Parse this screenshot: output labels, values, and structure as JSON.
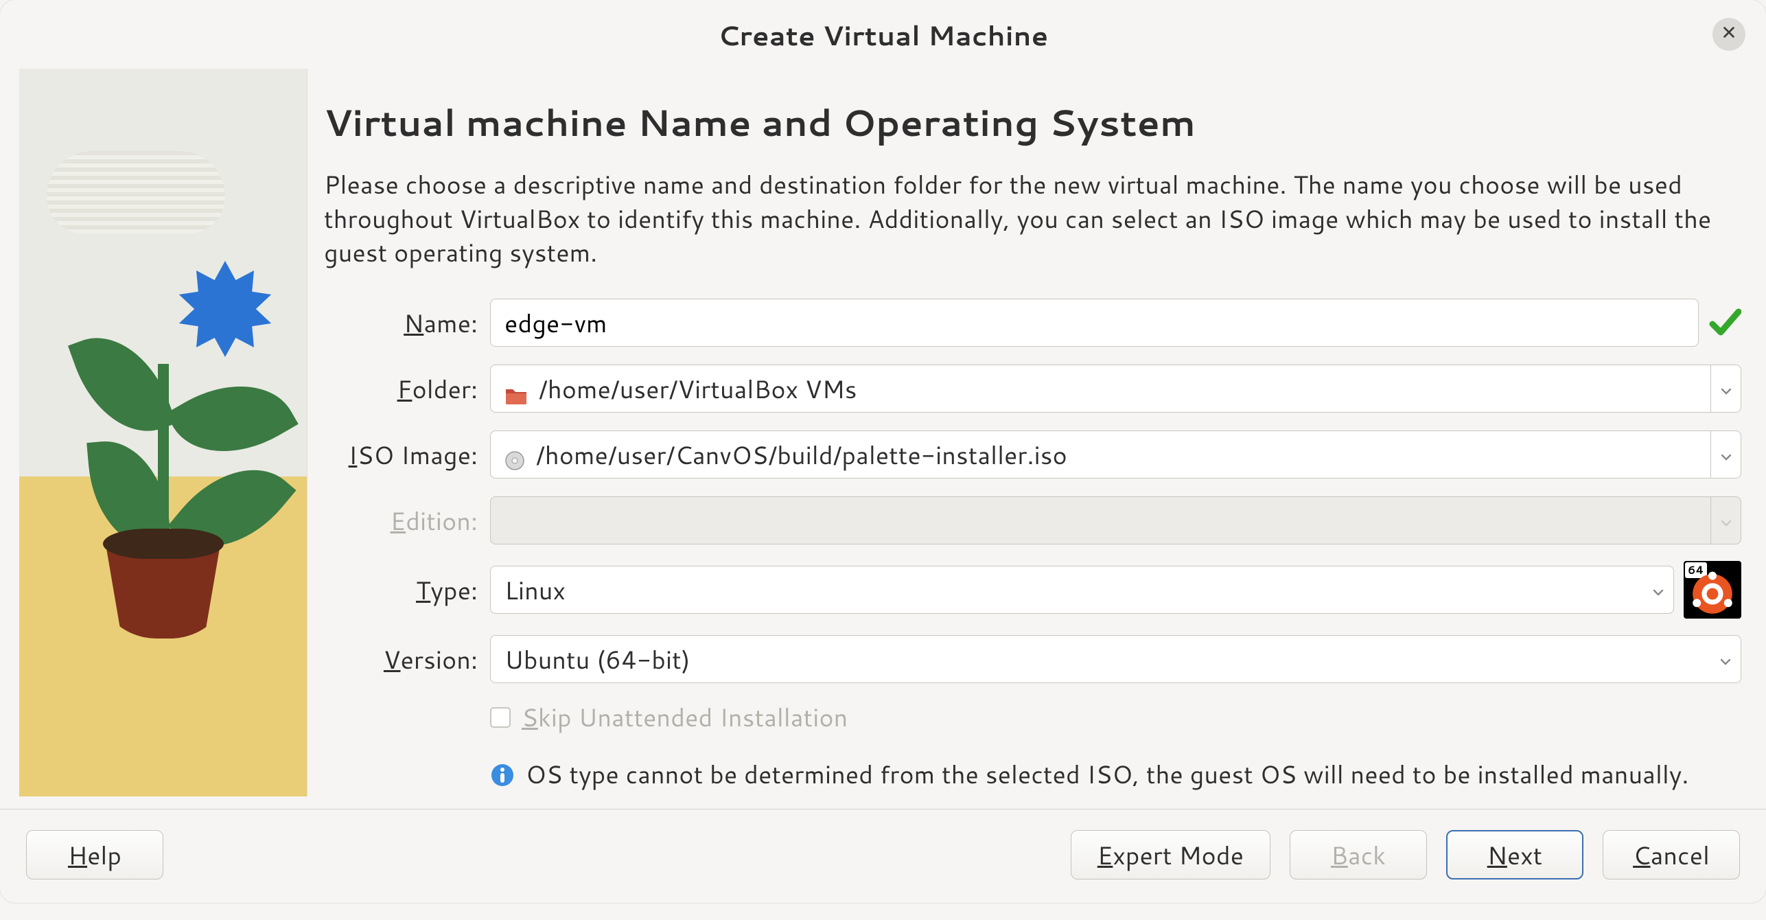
{
  "window": {
    "title": "Create Virtual Machine"
  },
  "page": {
    "heading": "Virtual machine Name and Operating System",
    "description": "Please choose a descriptive name and destination folder for the new virtual machine. The name you choose will be used throughout VirtualBox to identify this machine. Additionally, you can select an ISO image which may be used to install the guest operating system."
  },
  "form": {
    "name": {
      "label": "Name:",
      "value": "edge-vm"
    },
    "folder": {
      "label": "Folder:",
      "value": "/home/user/VirtualBox VMs"
    },
    "iso": {
      "label": "ISO Image:",
      "value": "/home/user/CanvOS/build/palette-installer.iso"
    },
    "edition": {
      "label": "Edition:",
      "value": ""
    },
    "type": {
      "label": "Type:",
      "value": "Linux"
    },
    "version": {
      "label": "Version:",
      "value": "Ubuntu (64-bit)"
    },
    "skip_unattended": {
      "label": "Skip Unattended Installation",
      "checked": false,
      "enabled": false
    },
    "info": "OS type cannot be determined from the selected ISO, the guest OS will need to be installed manually.",
    "os_badge": "64"
  },
  "buttons": {
    "help": "Help",
    "expert": "Expert Mode",
    "back": "Back",
    "next": "Next",
    "cancel": "Cancel"
  }
}
